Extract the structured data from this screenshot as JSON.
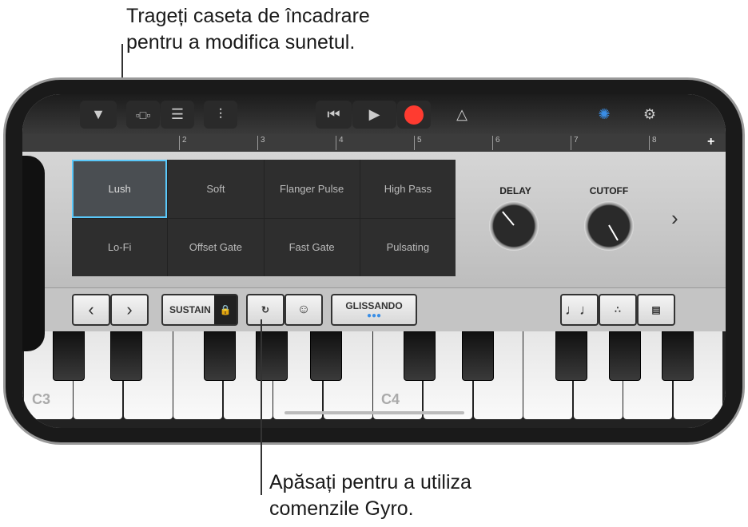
{
  "annotations": {
    "top": "Trageți caseta de încadrare\npentru a modifica sunetul.",
    "bottom": "Apăsați pentru a utiliza\ncomenzile Gyro."
  },
  "toolbar": {
    "icons": [
      "chevron-down-icon",
      "tracks-view-icon",
      "smart-controls-icon",
      "mixer-icon",
      "rewind-icon",
      "play-icon",
      "record-icon",
      "metronome-icon",
      "master-effects-icon",
      "settings-icon"
    ],
    "record_color": "#ff3b30",
    "accent": "#3a8ee6"
  },
  "ruler": {
    "marks": [
      "2",
      "3",
      "4",
      "5",
      "6",
      "7",
      "8"
    ],
    "add": "+"
  },
  "pads": [
    "Lush",
    "Soft",
    "Flanger Pulse",
    "High Pass",
    "Lo-Fi",
    "Offset Gate",
    "Fast Gate",
    "Pulsating"
  ],
  "selected_pad": "Lush",
  "knobs": [
    {
      "label": "DELAY"
    },
    {
      "label": "CUTOFF"
    }
  ],
  "next": "›",
  "controls": {
    "prev": "‹",
    "next": "›",
    "sustain": "SUSTAIN",
    "glissando": "GLISSANDO"
  },
  "keyboard": {
    "c3": "C3",
    "c4": "C4"
  }
}
